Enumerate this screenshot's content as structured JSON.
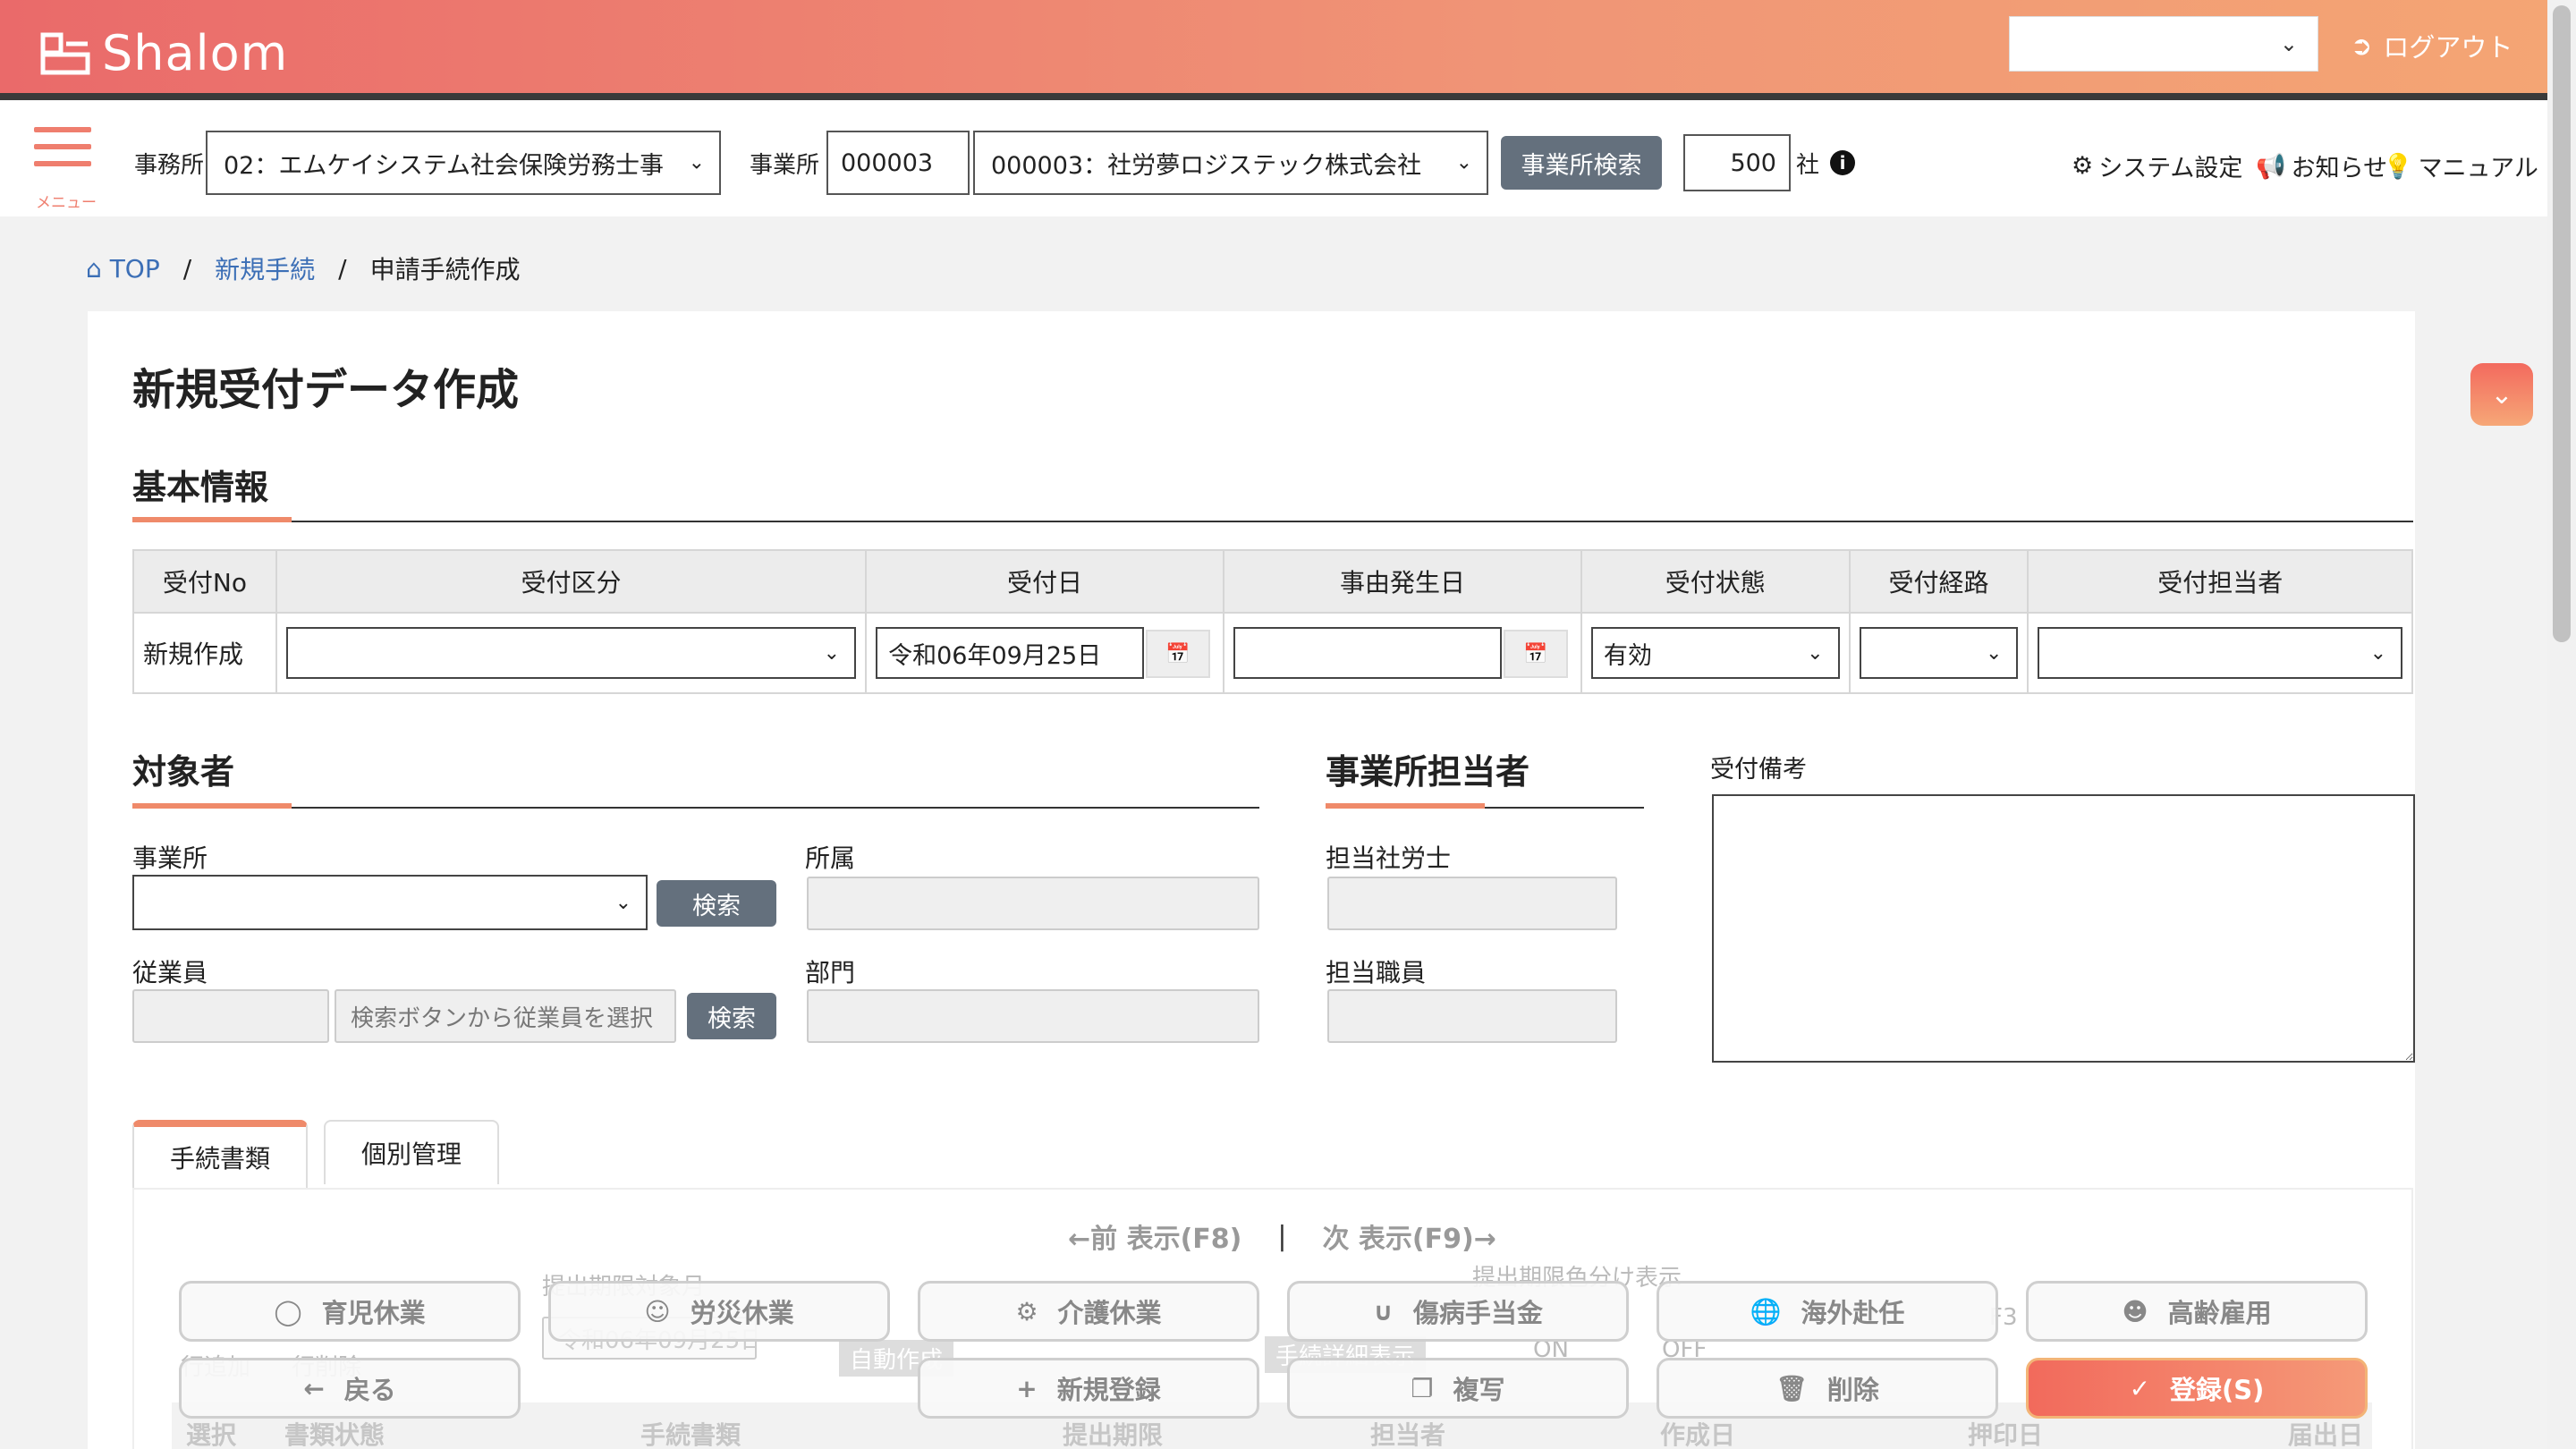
{
  "app": {
    "brand": "Shalom",
    "logout": "ログアウト",
    "header_select_value": ""
  },
  "toolbar": {
    "menu_label": "メニュー",
    "office_label": "事務所",
    "office_value": "02：エムケイシステム社会保険労務士事",
    "site_label": "事業所",
    "site_code": "000003",
    "site_value": "000003：社労夢ロジステック株式会社",
    "site_search": "事業所検索",
    "count": "500",
    "count_unit": "社",
    "system_settings": "システム設定",
    "notices": "お知らせ",
    "manual": "マニュアル"
  },
  "breadcrumb": [
    "TOP",
    "新規手続",
    "申請手続作成"
  ],
  "page_title": "新規受付データ作成",
  "basic": {
    "heading": "基本情報",
    "columns": [
      "受付No",
      "受付区分",
      "受付日",
      "事由発生日",
      "受付状態",
      "受付経路",
      "受付担当者"
    ],
    "values": {
      "no": "新規作成",
      "kubun": "",
      "date": "令和06年09月25日",
      "event_date": "",
      "status": "有効",
      "route": "",
      "staff": ""
    }
  },
  "subject": {
    "heading": "対象者",
    "site_label": "事業所",
    "search": "検索",
    "affiliation_label": "所属",
    "employee_label": "従業員",
    "employee_placeholder": "検索ボタンから従業員を選択",
    "department_label": "部門"
  },
  "contact": {
    "heading": "事業所担当者",
    "sharoushi_label": "担当社労士",
    "staff_label": "担当職員"
  },
  "remarks": {
    "label": "受付備考"
  },
  "tabs": [
    "手続書類",
    "個別管理"
  ],
  "pager": {
    "prev": "←前 表示(F8)",
    "next": "次 表示(F9)→"
  },
  "background_faded": {
    "period_label": "提出期限対象月",
    "date_value": "令和06年09月25日",
    "color_label": "提出期限色分け表示",
    "auto_create": "自動作成",
    "list_display": "手続詳細表示",
    "row_add": "行追加",
    "row_delete": "行削除",
    "on": "ON",
    "off": "OFF",
    "f3": "F3",
    "headers": [
      "選択",
      "書類状態",
      "手続書類",
      "提出期限",
      "担当者",
      "作成日",
      "押印日",
      "届出日"
    ]
  },
  "floating_buttons": [
    {
      "label": "育児休業",
      "icon": "baby-carriage-icon"
    },
    {
      "label": "労災休業",
      "icon": "injured-person-icon"
    },
    {
      "label": "介護休業",
      "icon": "cane-walker-icon"
    },
    {
      "label": "傷病手当金",
      "icon": "stethoscope-icon"
    },
    {
      "label": "海外赴任",
      "icon": "globe-icon"
    },
    {
      "label": "高齢雇用",
      "icon": "person-icon"
    },
    {
      "label": "戻る",
      "icon": "arrow-left-icon"
    },
    {
      "label": "新規登録",
      "icon": "plus-icon"
    },
    {
      "label": "複写",
      "icon": "copy-icon"
    },
    {
      "label": "削除",
      "icon": "trash-icon"
    },
    {
      "label": "登録(S)",
      "icon": "check-icon"
    }
  ]
}
